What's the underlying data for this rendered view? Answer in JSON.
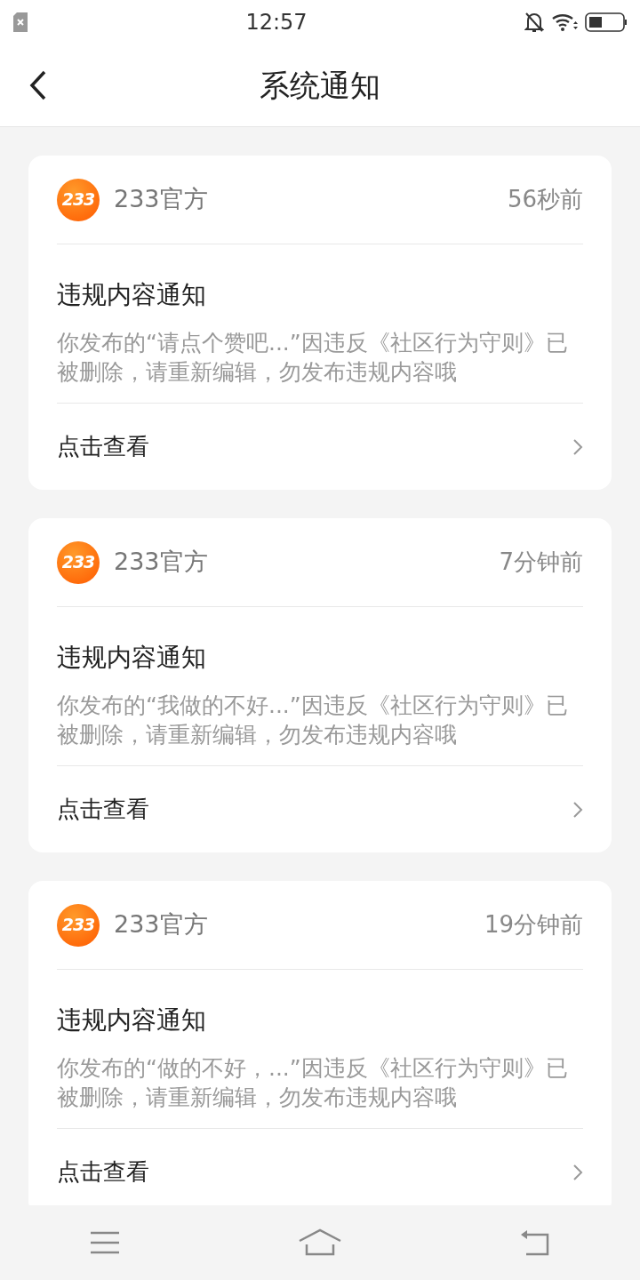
{
  "status_bar": {
    "time": "12:57"
  },
  "header": {
    "title": "系统通知"
  },
  "notifications": [
    {
      "logo_text": "233",
      "sender": "233官方",
      "time": "56秒前",
      "title": "违规内容通知",
      "body": "你发布的“请点个赞吧...”因违反《社区行为守则》已被删除，请重新编辑，勿发布违规内容哦",
      "action": "点击查看"
    },
    {
      "logo_text": "233",
      "sender": "233官方",
      "time": "7分钟前",
      "title": "违规内容通知",
      "body": "你发布的“我做的不好...”因违反《社区行为守则》已被删除，请重新编辑，勿发布违规内容哦",
      "action": "点击查看"
    },
    {
      "logo_text": "233",
      "sender": "233官方",
      "time": "19分钟前",
      "title": "违规内容通知",
      "body": "你发布的“做的不好，...”因违反《社区行为守则》已被删除，请重新编辑，勿发布违规内容哦",
      "action": "点击查看"
    }
  ]
}
